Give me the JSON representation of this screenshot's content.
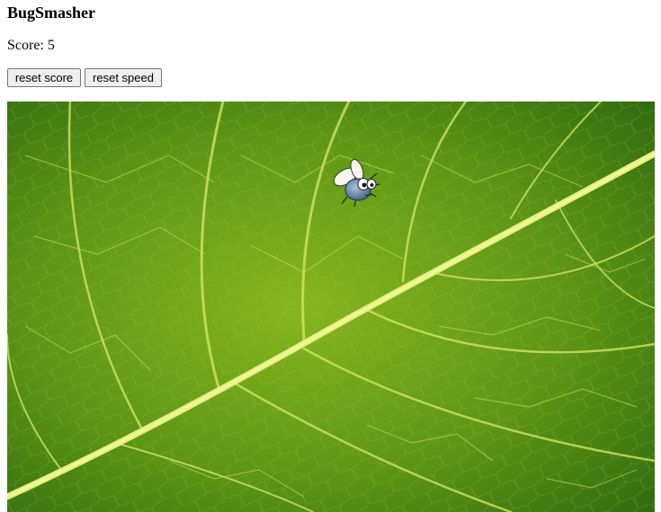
{
  "app": {
    "title": "BugSmasher"
  },
  "score": {
    "label": "Score: ",
    "value": 5
  },
  "controls": {
    "reset_score_label": "reset score",
    "reset_speed_label": "reset speed"
  },
  "game": {
    "background": "leaf-texture",
    "bug_sprite": "fly-bug-icon",
    "colors": {
      "leaf_dark": "#2f6a0f",
      "leaf_mid": "#5f9a17",
      "leaf_light": "#a8c933",
      "vein": "#d8ec6a",
      "bug_body": "#6e8fb2"
    }
  }
}
